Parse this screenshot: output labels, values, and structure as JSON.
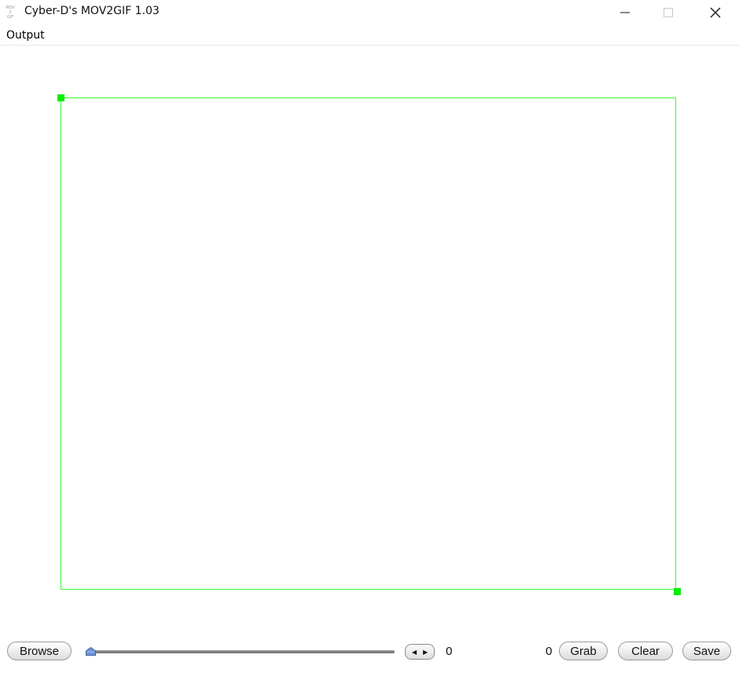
{
  "window": {
    "title": "Cyber-D's MOV2GIF 1.03",
    "app_icon_text": [
      "MOV",
      "2",
      "GIF"
    ],
    "controls": {
      "minimize": "minimize-icon",
      "maximize": "maximize-icon",
      "close": "close-icon"
    }
  },
  "menubar": {
    "items": [
      {
        "label": "Output"
      }
    ]
  },
  "selection": {
    "color": "#33ff33",
    "handle_color": "#00ee00"
  },
  "toolbar": {
    "browse_label": "Browse",
    "frame_value": "0",
    "grab_count": "0",
    "grab_label": "Grab",
    "clear_label": "Clear",
    "save_label": "Save",
    "slider_position": 0
  }
}
